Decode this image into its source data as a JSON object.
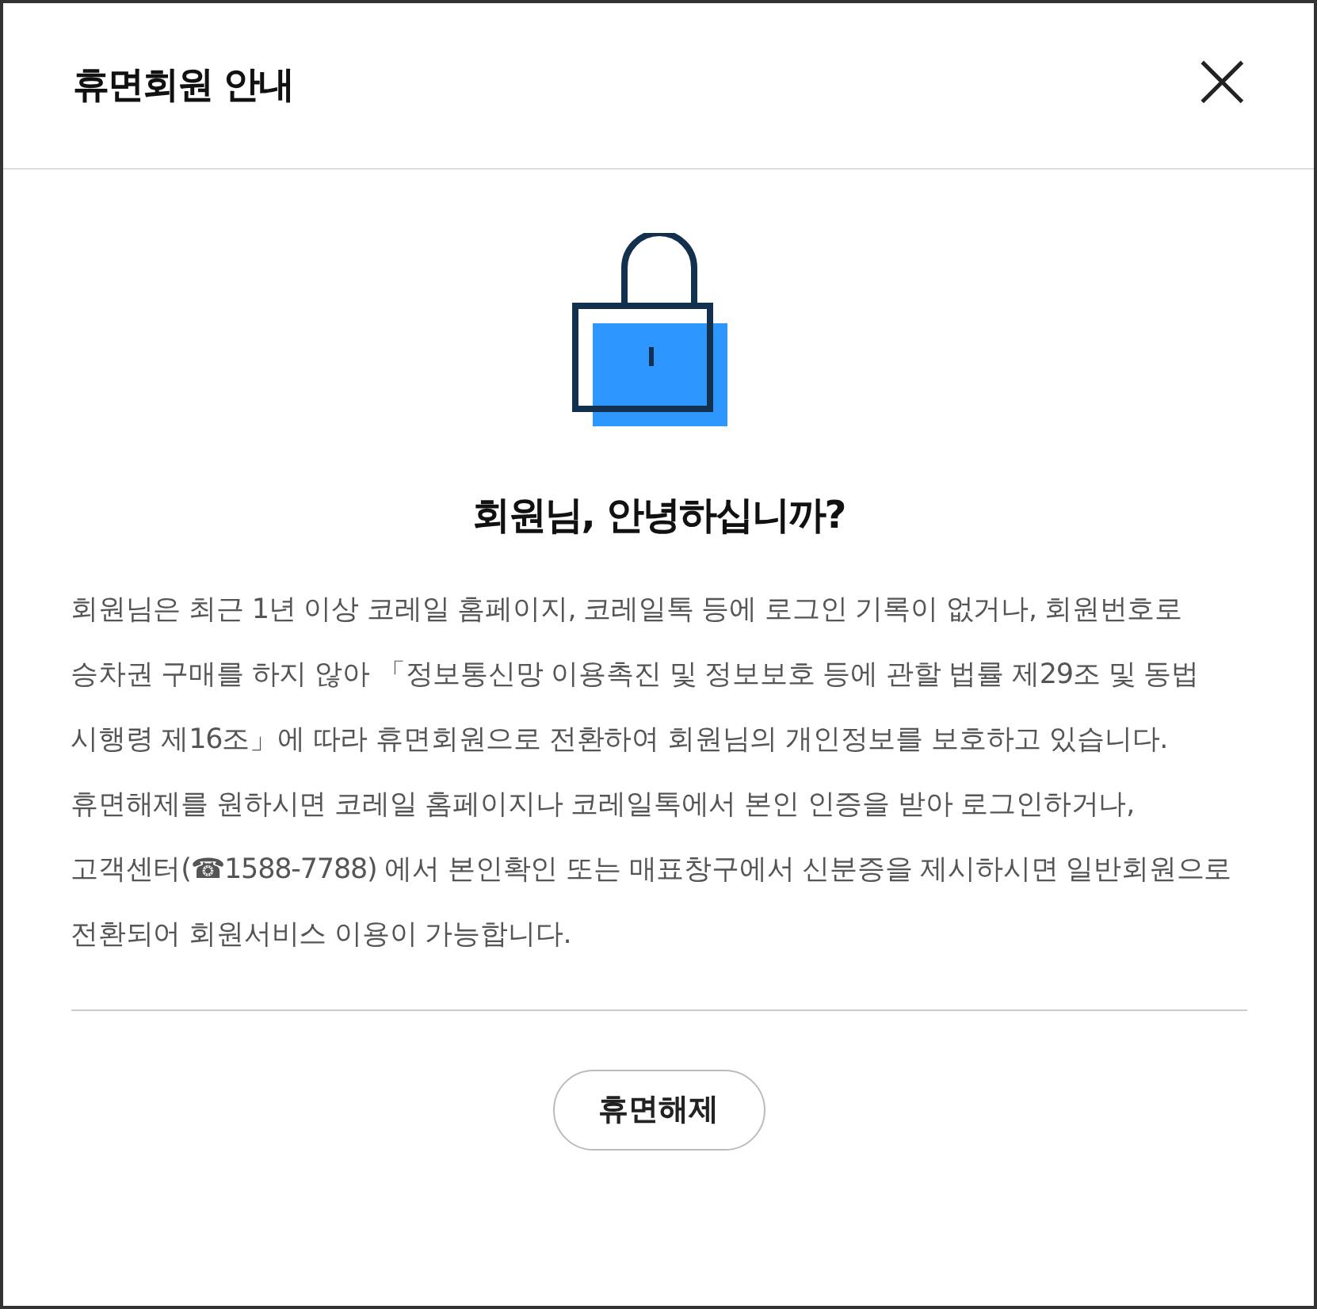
{
  "dialog": {
    "title": "휴면회원 안내",
    "close": "×",
    "heading": "회원님, 안녕하십니까?",
    "message": "회원님은 최근 1년 이상 코레일 홈페이지, 코레일톡 등에 로그인 기록이 없거나, 회원번호로 승차권 구매를 하지 않아 「정보통신망 이용촉진 및 정보보호 등에 관할 법률 제29조 및 동법 시행령 제16조」에 따라 휴면회원으로 전환하여 회원님의 개인정보를 보호하고 있습니다. 휴면해제를 원하시면 코레일 홈페이지나 코레일톡에서 본인 인증을 받아 로그인하거나, 고객센터(☎1588-7788) 에서 본인확인 또는 매표창구에서 신분증을 제시하시면 일반회원으로 전환되어 회원서비스 이용이 가능합니다.",
    "button": "휴면해제"
  }
}
